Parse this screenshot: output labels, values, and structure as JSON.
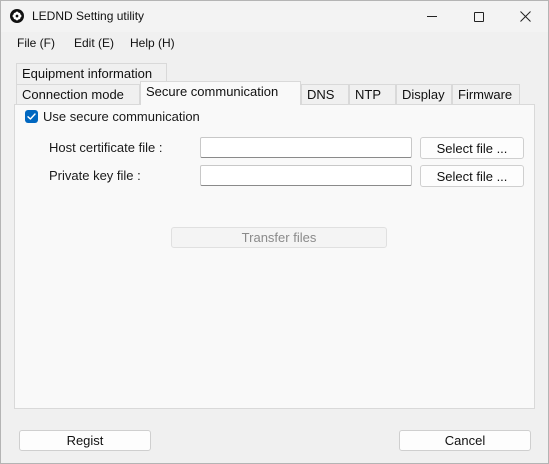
{
  "window": {
    "title": "LEDND Setting utility"
  },
  "menu": {
    "file": "File (F)",
    "edit": "Edit (E)",
    "help": "Help (H)"
  },
  "tabs": {
    "top_row": [
      "Equipment information"
    ],
    "bottom_row": [
      "Connection mode",
      "Secure communication",
      "DNS",
      "NTP",
      "Display",
      "Firmware"
    ],
    "active": "Secure communication"
  },
  "secure": {
    "use_secure_label": "Use secure communication",
    "use_secure_checked": true,
    "host_cert_label": "Host certificate file :",
    "host_cert_value": "",
    "private_key_label": "Private key file :",
    "private_key_value": "",
    "select_file_label": "Select file ...",
    "transfer_label": "Transfer files"
  },
  "footer": {
    "regist_label": "Regist",
    "cancel_label": "Cancel"
  },
  "colors": {
    "accent": "#0067c0",
    "window_bg": "#f0f0f0",
    "panel_bg": "#f9f9f9"
  }
}
